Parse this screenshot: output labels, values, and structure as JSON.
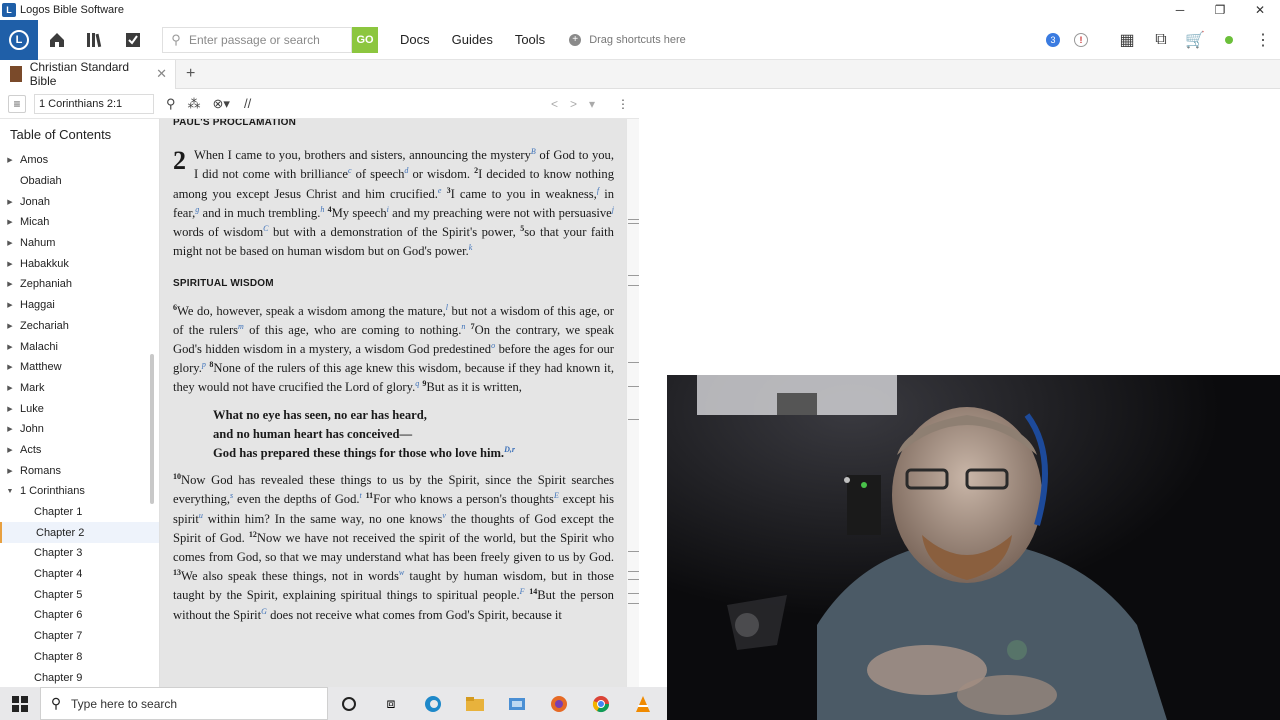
{
  "window": {
    "title": "Logos Bible Software",
    "minimize": "─",
    "restore": "❐",
    "close": "✕"
  },
  "toolbar": {
    "search_placeholder": "Enter passage or search",
    "go_label": "GO",
    "menu": [
      "Docs",
      "Guides",
      "Tools"
    ],
    "shortcuts_label": "Drag shortcuts here",
    "notification_count": "3",
    "alert_label": "!"
  },
  "tab": {
    "title": "Christian Standard Bible",
    "close": "✕",
    "add": "+"
  },
  "panel": {
    "reference": "1 Corinthians 2:1",
    "parallel_label": "//"
  },
  "toc": {
    "title": "Table of Contents",
    "books": [
      {
        "label": "Amos",
        "arrow": true
      },
      {
        "label": "Obadiah",
        "arrow": false
      },
      {
        "label": "Jonah",
        "arrow": true
      },
      {
        "label": "Micah",
        "arrow": true
      },
      {
        "label": "Nahum",
        "arrow": true
      },
      {
        "label": "Habakkuk",
        "arrow": true
      },
      {
        "label": "Zephaniah",
        "arrow": true
      },
      {
        "label": "Haggai",
        "arrow": true
      },
      {
        "label": "Zechariah",
        "arrow": true
      },
      {
        "label": "Malachi",
        "arrow": true
      },
      {
        "label": "Matthew",
        "arrow": true
      },
      {
        "label": "Mark",
        "arrow": true
      },
      {
        "label": "Luke",
        "arrow": true
      },
      {
        "label": "John",
        "arrow": true
      },
      {
        "label": "Acts",
        "arrow": true
      },
      {
        "label": "Romans",
        "arrow": true
      },
      {
        "label": "1 Corinthians",
        "arrow": true,
        "expanded": true
      }
    ],
    "chapters": [
      "Chapter 1",
      "Chapter 2",
      "Chapter 3",
      "Chapter 4",
      "Chapter 5",
      "Chapter 6",
      "Chapter 7",
      "Chapter 8",
      "Chapter 9"
    ],
    "selected_chapter": "Chapter 2"
  },
  "reader": {
    "heading_top": "PAUL'S PROCLAMATION",
    "chapter_number": "2",
    "heading_wisdom": "SPIRITUAL WISDOM",
    "p1": [
      {
        "t": "When I came to you, brothers and sisters, announcing the mystery"
      },
      {
        "fn": "B"
      },
      {
        "t": " of God to you, I did not come with brilliance"
      },
      {
        "fn": "c"
      },
      {
        "t": " of speech"
      },
      {
        "fn": "d"
      },
      {
        "t": " or wisdom. "
      },
      {
        "vn": "2"
      },
      {
        "t": "I decided to know nothing among you except Jesus Christ and him crucified."
      },
      {
        "fn": "e"
      },
      {
        "t": " "
      },
      {
        "vn": "3"
      },
      {
        "t": "I came to you in weakness,"
      },
      {
        "fn": "f"
      },
      {
        "t": " in fear,"
      },
      {
        "fn": "g"
      },
      {
        "t": " and in much trembling."
      },
      {
        "fn": "h"
      },
      {
        "t": " "
      },
      {
        "vn": "4"
      },
      {
        "t": "My speech"
      },
      {
        "fn": "i"
      },
      {
        "t": " and my preaching were not with persuasive"
      },
      {
        "fn": "j"
      },
      {
        "t": " words of wisdom"
      },
      {
        "fn": "C"
      },
      {
        "t": " but with a demonstration of the Spirit's power, "
      },
      {
        "vn": "5"
      },
      {
        "t": "so that your faith might not be based on human wisdom but on God's power."
      },
      {
        "fn": "k"
      }
    ],
    "p2": [
      {
        "vn": "6"
      },
      {
        "t": "We do, however, speak a wisdom among the mature,"
      },
      {
        "fn": "l"
      },
      {
        "t": " but not a wisdom of this age, or of the rulers"
      },
      {
        "fn": "m"
      },
      {
        "t": " of this age, who are coming to nothing."
      },
      {
        "fn": "n"
      },
      {
        "t": " "
      },
      {
        "vn": "7"
      },
      {
        "t": "On the contrary, we speak God's hidden wisdom in a mystery, a wisdom God predestined"
      },
      {
        "fn": "o"
      },
      {
        "t": " before the ages for our glory."
      },
      {
        "fn": "p"
      },
      {
        "t": " "
      },
      {
        "vn": "8"
      },
      {
        "t": "None of the rulers of this age knew this wisdom, because if they had known it, they would not have crucified the Lord of glory."
      },
      {
        "fn": "q"
      },
      {
        "t": " "
      },
      {
        "vn": "9"
      },
      {
        "t": "But as it is written,"
      }
    ],
    "poem": [
      "What no eye has seen, no ear has heard,",
      "and no human heart has conceived—",
      "God has prepared these things for those who love him."
    ],
    "poem_fn": "D,r",
    "p3": [
      {
        "vn": "10"
      },
      {
        "t": "Now God has revealed these things to us by the Spirit, since the Spirit searches everything,"
      },
      {
        "fn": "s"
      },
      {
        "t": " even the depths of God."
      },
      {
        "fn": "t"
      },
      {
        "t": " "
      },
      {
        "vn": "11"
      },
      {
        "t": "For who knows a person's thoughts"
      },
      {
        "fn": "E"
      },
      {
        "t": " except his spirit"
      },
      {
        "fn": "u"
      },
      {
        "t": " within him? In the same way, no one knows"
      },
      {
        "fn": "v"
      },
      {
        "t": " the thoughts of God except the Spirit of God. "
      },
      {
        "vn": "12"
      },
      {
        "t": "Now we have not received the spirit of the world, but the Spirit who comes from God, so that we may understand what has been freely given to us by God. "
      },
      {
        "vn": "13"
      },
      {
        "t": "We also speak these things, not in words"
      },
      {
        "fn": "w"
      },
      {
        "t": " taught by human wisdom, but in those taught by the Spirit, explaining spiritual things to spiritual people."
      },
      {
        "fn": "F"
      },
      {
        "t": " "
      },
      {
        "vn": "14"
      },
      {
        "t": "But the person without the Spirit"
      },
      {
        "fn": "G"
      },
      {
        "t": " does not receive what comes from God's Spirit, because it"
      }
    ]
  },
  "taskbar": {
    "search_placeholder": "Type here to search"
  },
  "colors": {
    "logos_blue": "#1f5fa8",
    "go_green": "#8cc63f",
    "reader_bg": "#e5e5e5",
    "footnote_blue": "#3a6fb8"
  }
}
